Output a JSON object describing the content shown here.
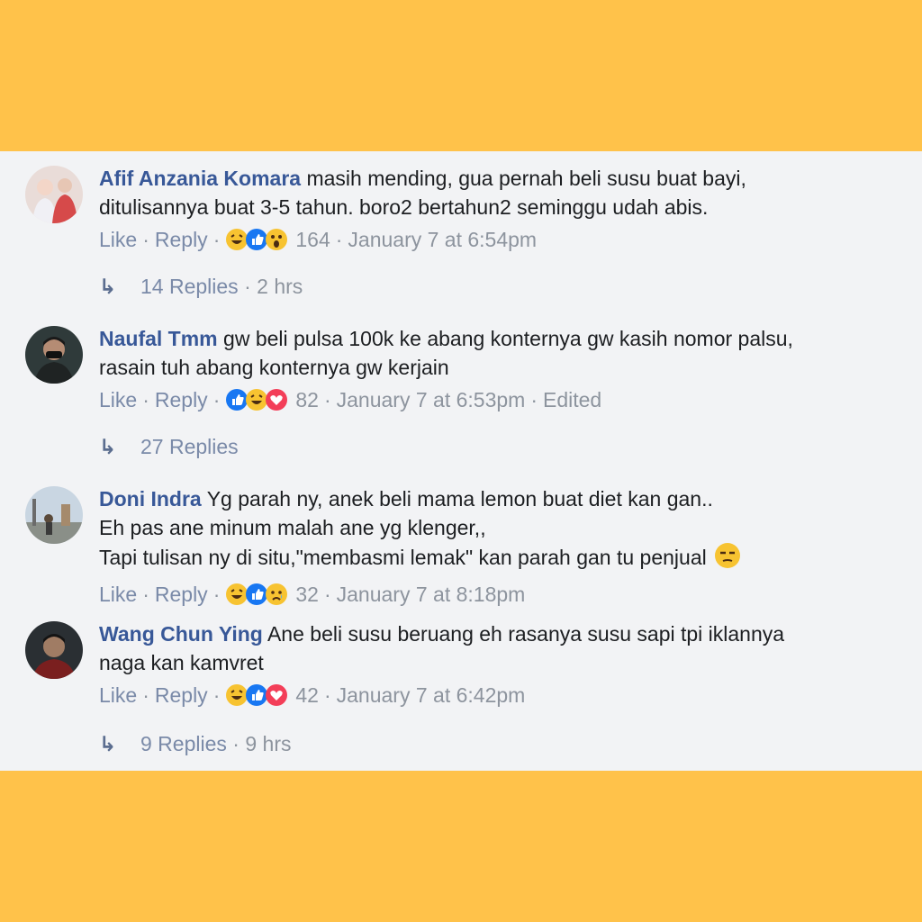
{
  "comments": [
    {
      "author": "Afif Anzania Komara",
      "lines": [
        "masih mending, gua pernah beli susu buat bayi,",
        "ditulisannya buat 3-5 tahun. boro2 bertahun2 seminggu udah abis."
      ],
      "like_label": "Like",
      "reply_label": "Reply",
      "reactions": [
        "haha",
        "like",
        "wow"
      ],
      "reaction_count": "164",
      "timestamp": "January 7 at 6:54pm",
      "edited": "",
      "replies_label": "14 Replies",
      "replies_time": "2 hrs"
    },
    {
      "author": "Naufal Tmm",
      "lines": [
        "gw beli pulsa 100k ke abang konternya gw kasih nomor palsu,",
        "rasain tuh abang konternya gw kerjain"
      ],
      "like_label": "Like",
      "reply_label": "Reply",
      "reactions": [
        "like",
        "haha",
        "love"
      ],
      "reaction_count": "82",
      "timestamp": "January 7 at 6:53pm",
      "edited": "Edited",
      "replies_label": "27 Replies",
      "replies_time": ""
    },
    {
      "author": "Doni Indra",
      "lines": [
        "Yg parah ny, anek beli mama lemon buat diet kan gan..",
        "Eh pas ane minum malah ane yg klenger,,",
        "Tapi tulisan ny di situ,\"membasmi lemak\" kan parah gan tu penjual"
      ],
      "like_label": "Like",
      "reply_label": "Reply",
      "reactions": [
        "haha",
        "like",
        "sad"
      ],
      "reaction_count": "32",
      "timestamp": "January 7 at 8:18pm",
      "edited": "",
      "replies_label": "",
      "replies_time": ""
    },
    {
      "author": "Wang Chun Ying",
      "lines": [
        "Ane beli susu beruang eh rasanya susu sapi tpi iklannya",
        "naga kan kamvret"
      ],
      "like_label": "Like",
      "reply_label": "Reply",
      "reactions": [
        "haha",
        "like",
        "love"
      ],
      "reaction_count": "42",
      "timestamp": "January 7 at 6:42pm",
      "edited": "",
      "replies_label": "9 Replies",
      "replies_time": "9 hrs"
    }
  ],
  "colors": {
    "frame": "#ffc24a",
    "panel": "#f2f3f5",
    "author": "#385898",
    "meta": "#8d949e"
  },
  "icons": {
    "reply_arrow": "reply-arrow-icon",
    "inline_emoji": "unamused-face-icon"
  }
}
